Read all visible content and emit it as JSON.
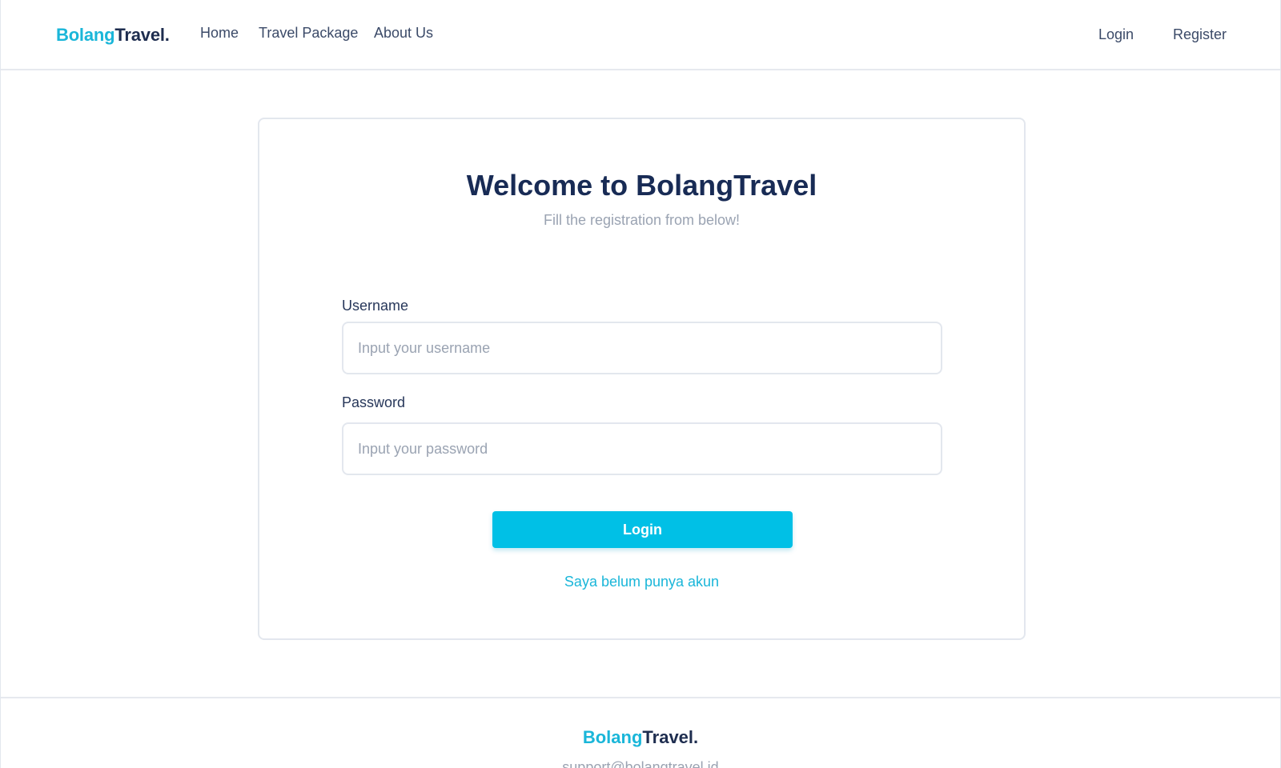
{
  "header": {
    "brand": {
      "part1": "Bolang",
      "part2": "Travel."
    },
    "nav": [
      {
        "label": "Home"
      },
      {
        "label": "Travel Package"
      },
      {
        "label": "About Us"
      }
    ],
    "auth": {
      "login": "Login",
      "register": "Register"
    }
  },
  "card": {
    "title": "Welcome to BolangTravel",
    "subtitle": "Fill the registration from below!",
    "username": {
      "label": "Username",
      "placeholder": "Input your username",
      "value": ""
    },
    "password": {
      "label": "Password",
      "placeholder": "Input your password",
      "value": ""
    },
    "login_button": "Login",
    "signup_link": "Saya belum punya akun"
  },
  "footer": {
    "brand": {
      "part1": "Bolang",
      "part2": "Travel."
    },
    "email": "support@bolangtravel.id"
  },
  "colors": {
    "accent": "#00c0e6",
    "brand_cyan": "#1ab6d9",
    "navy": "#182b55",
    "muted": "#9aa3b2"
  }
}
